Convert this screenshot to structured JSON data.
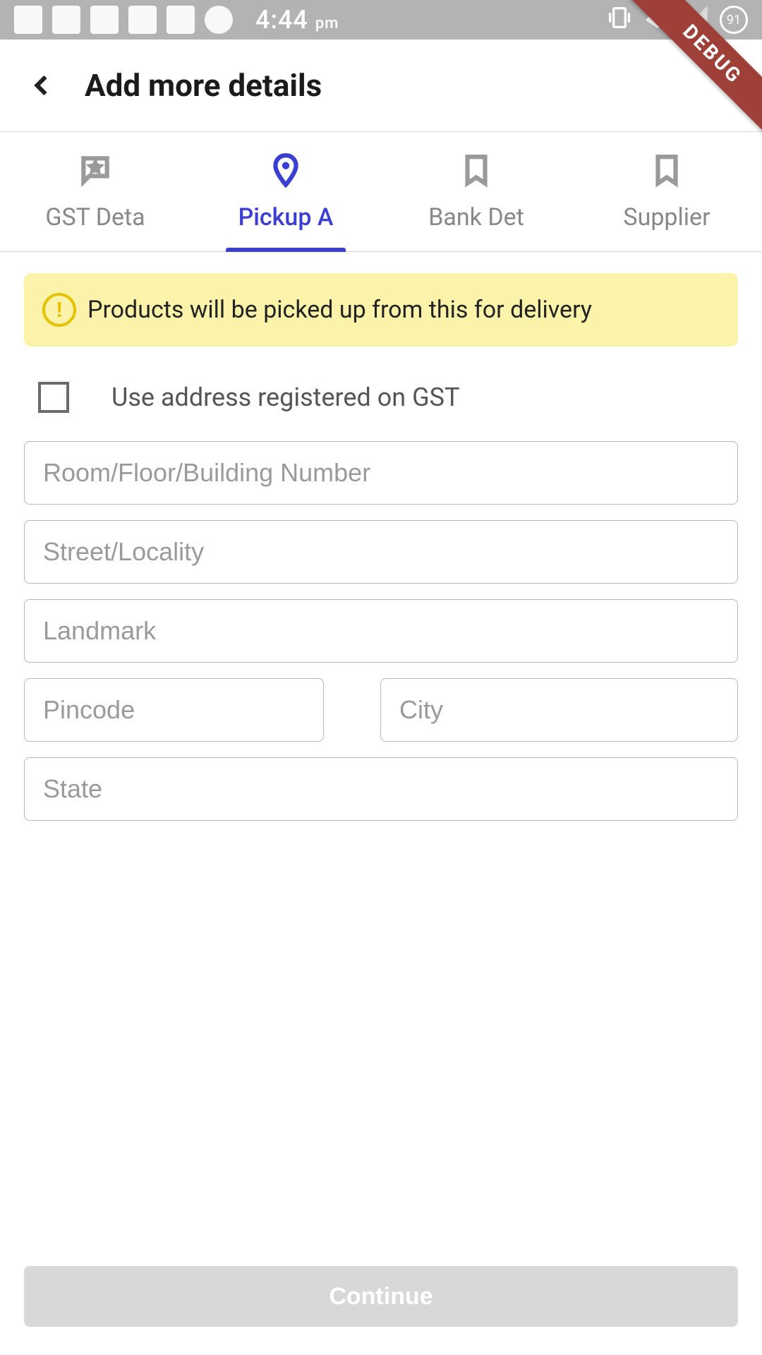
{
  "status": {
    "time": "4:44",
    "time_suffix": "pm",
    "battery": "91"
  },
  "debug_label": "DEBUG",
  "header": {
    "title": "Add more details"
  },
  "tabs": [
    {
      "label": "GST Deta"
    },
    {
      "label": "Pickup A"
    },
    {
      "label": "Bank Det"
    },
    {
      "label": "Supplier "
    }
  ],
  "active_tab_index": 1,
  "banner": {
    "text": "Products will be picked up from this for delivery"
  },
  "checkbox": {
    "label": "Use address registered on GST",
    "checked": false
  },
  "fields": {
    "room": {
      "placeholder": "Room/Floor/Building Number",
      "value": ""
    },
    "street": {
      "placeholder": "Street/Locality",
      "value": ""
    },
    "landmark": {
      "placeholder": "Landmark",
      "value": ""
    },
    "pincode": {
      "placeholder": "Pincode",
      "value": ""
    },
    "city": {
      "placeholder": "City",
      "value": ""
    },
    "state": {
      "placeholder": "State",
      "value": ""
    }
  },
  "cta": {
    "label": "Continue",
    "enabled": false
  },
  "colors": {
    "accent": "#3b3fd1",
    "banner_bg": "#fbf3a9",
    "disabled": "#d8d8d8"
  }
}
